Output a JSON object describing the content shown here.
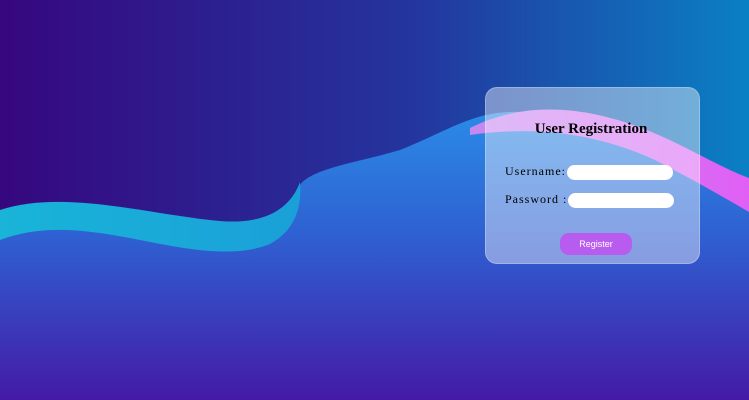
{
  "background": {
    "top_left_color": "#36077f",
    "top_right_color": "#0a80c4",
    "lower_gradient_top": "#2a8be6",
    "lower_gradient_bottom": "#441aa6",
    "ribbon_cyan": "#19b4d8",
    "ribbon_pink": "#e47cf5"
  },
  "form": {
    "title": "User Registration",
    "username_label": "Username:",
    "username_value": "",
    "password_label": "Password :",
    "password_value": "",
    "register_label": "Register",
    "register_color": "#b85cf0"
  }
}
